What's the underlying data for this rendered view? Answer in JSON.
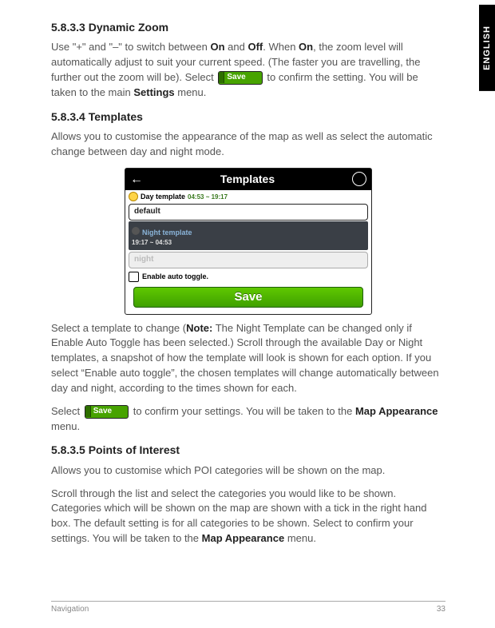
{
  "lang_tab": "ENGLISH",
  "h1": {
    "num": "5.8.3.3",
    "title": "Dynamic Zoom"
  },
  "p1a": "Use \"+\"  and \"–\" to switch between ",
  "p1_on": "On",
  "p1b": " and ",
  "p1_off": "Off",
  "p1c": ". When ",
  "p1_on2": "On",
  "p1d": ", the zoom level will automatically adjust to suit your current speed. (The faster you are travelling, the further out the zoom will be). Select ",
  "p1e": " to confirm the setting. You will be taken to the main ",
  "p1_settings": "Settings",
  "p1f": " menu.",
  "save_label": "Save",
  "h2": {
    "num": "5.8.3.4",
    "title": "Templates"
  },
  "p2": "Allows you to customise the appearance of the map as well as select the automatic change between day and night mode.",
  "device": {
    "title": "Templates",
    "day_label": "Day template",
    "day_times": "04:53 ~ 19:17",
    "day_value": "default",
    "night_label": "Night template",
    "night_times": "19:17 ~ 04:53",
    "night_value": "night",
    "toggle_label": "Enable auto toggle.",
    "save": "Save"
  },
  "p3a": "Select a template to change (",
  "p3_note": "Note:",
  "p3b": " The Night Template can be changed only if Enable Auto Toggle has been selected.) Scroll through the available Day or Night templates, a snapshot of how the template will look is shown for each option. If you select “Enable auto toggle”, the chosen templates will change automatically between day and night, according to the times shown for each.",
  "p4a": "Select ",
  "p4b": " to confirm your settings. You will be taken to the ",
  "p4_map": "Map Appearance",
  "p4c": " menu.",
  "h3": {
    "num": "5.8.3.5",
    "title": "Points of Interest"
  },
  "p5": "Allows you to customise which POI categories will be shown on the map.",
  "p6a": "Scroll through the list and select the categories you would like to be shown. Categories which will be shown on the map are shown with a tick in the right hand box. The default setting is for all categories to be shown. Select to confirm your settings. You will be taken to the ",
  "p6_map": "Map Appearance",
  "p6b": " menu.",
  "footer": {
    "section": "Navigation",
    "page": "33"
  }
}
